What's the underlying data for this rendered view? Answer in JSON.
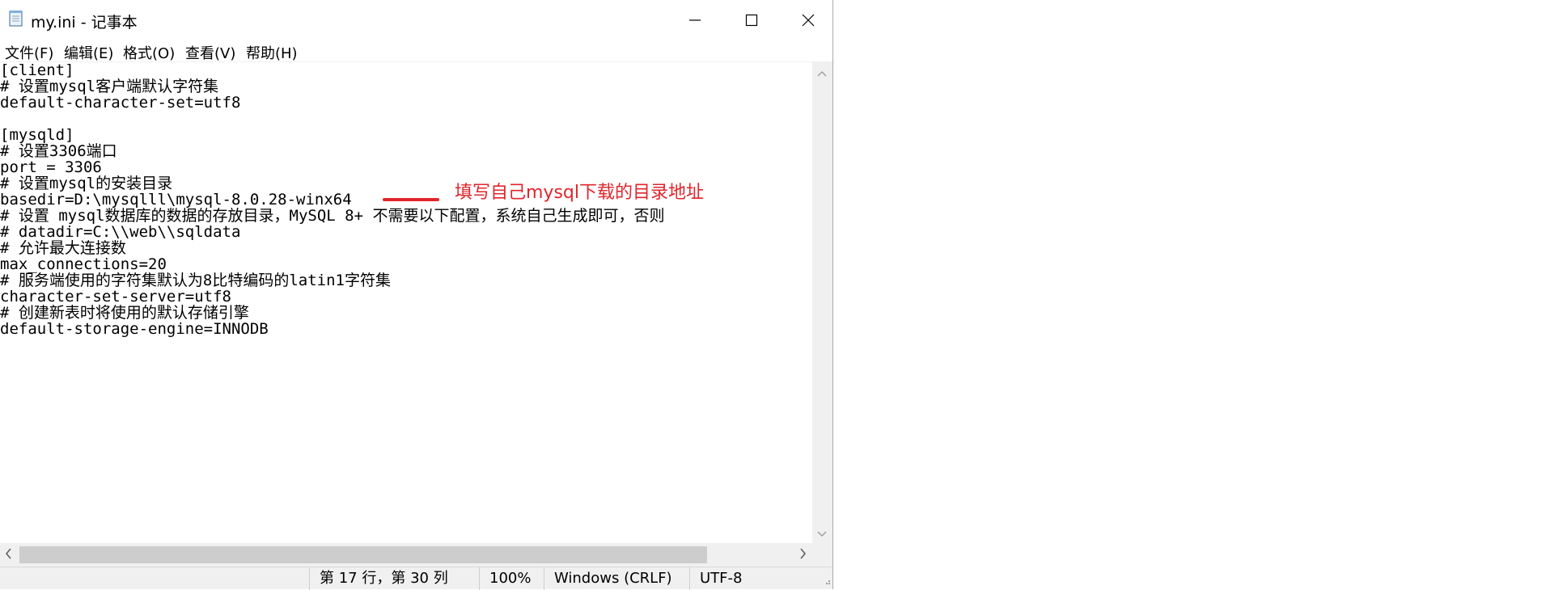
{
  "window": {
    "title": "my.ini - 记事本"
  },
  "menu": [
    {
      "label": "文件(F)"
    },
    {
      "label": "编辑(E)"
    },
    {
      "label": "格式(O)"
    },
    {
      "label": "查看(V)"
    },
    {
      "label": "帮助(H)"
    }
  ],
  "editor": {
    "lines": [
      "[client]",
      "# 设置mysql客户端默认字符集",
      "default-character-set=utf8",
      "",
      "[mysqld]",
      "# 设置3306端口",
      "port = 3306",
      "# 设置mysql的安装目录",
      "basedir=D:\\mysqlll\\mysql-8.0.28-winx64",
      "# 设置 mysql数据库的数据的存放目录，MySQL 8+ 不需要以下配置，系统自己生成即可，否则",
      "# datadir=C:\\\\web\\\\sqldata",
      "# 允许最大连接数",
      "max_connections=20",
      "# 服务端使用的字符集默认为8比特编码的latin1字符集",
      "character-set-server=utf8",
      "# 创建新表时将使用的默认存储引擎",
      "default-storage-engine=INNODB"
    ]
  },
  "annotation": {
    "text": "填写自己mysql下载的目录地址",
    "color": "#e0252c"
  },
  "status": {
    "position": "第 17 行，第 30 列",
    "zoom": "100%",
    "line_ending": "Windows (CRLF)",
    "encoding": "UTF-8"
  }
}
